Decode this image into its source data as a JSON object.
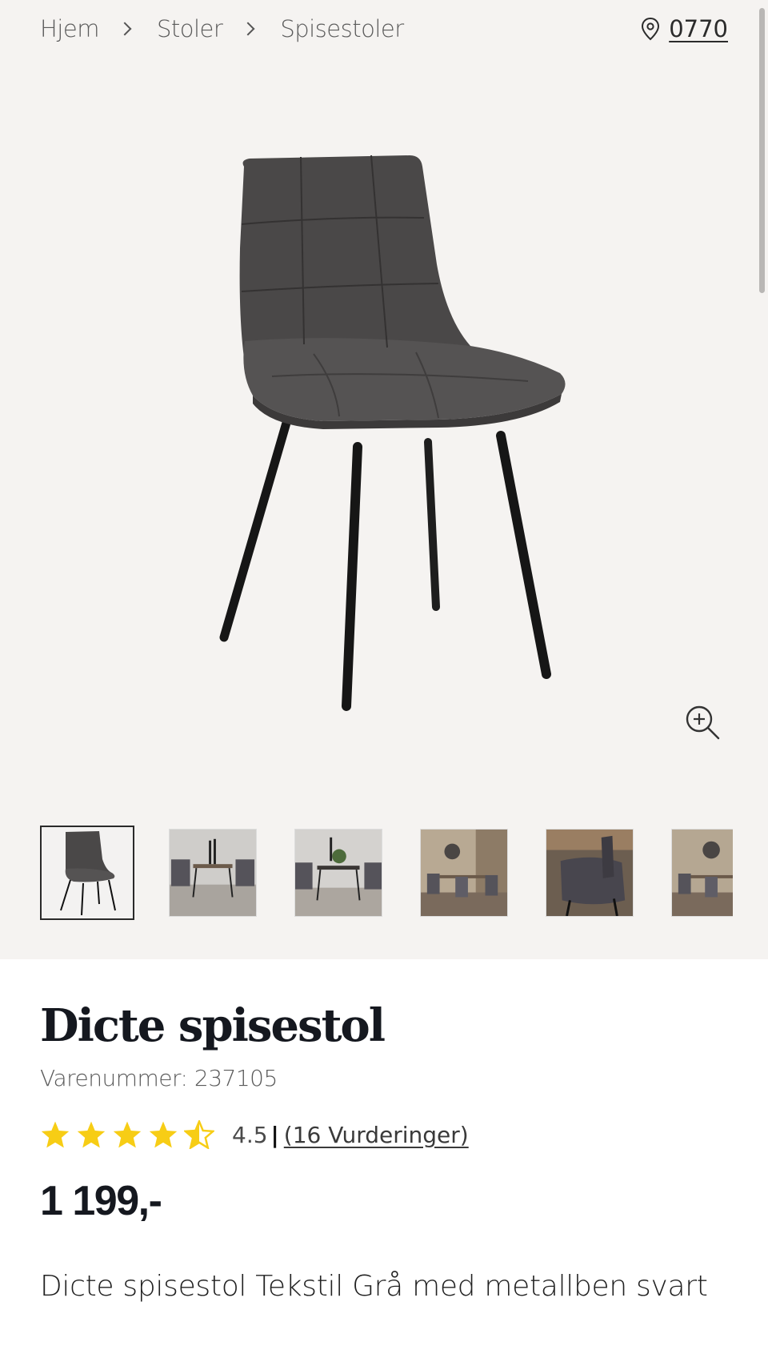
{
  "breadcrumb": {
    "items": [
      "Hjem",
      "Stoler",
      "Spisestoler"
    ]
  },
  "store": {
    "postcode": "0770",
    "icon": "location-pin-icon"
  },
  "gallery": {
    "zoom_icon": "zoom-in-icon",
    "thumbnail_count": 6,
    "active_index": 0
  },
  "product": {
    "title": "Dicte spisestol",
    "sku_label": "Varenummer:",
    "sku": "237105",
    "rating_value": "4.5",
    "rating_separator": "|",
    "reviews_text": "(16 Vurderinger)",
    "stars": 4.5,
    "price": "1 199,-",
    "description": "Dicte spisestol Tekstil Grå med metallben svart"
  },
  "colors": {
    "star": "#f7cd15",
    "page_bg": "#f5f3f1",
    "text_dark": "#15181f"
  }
}
